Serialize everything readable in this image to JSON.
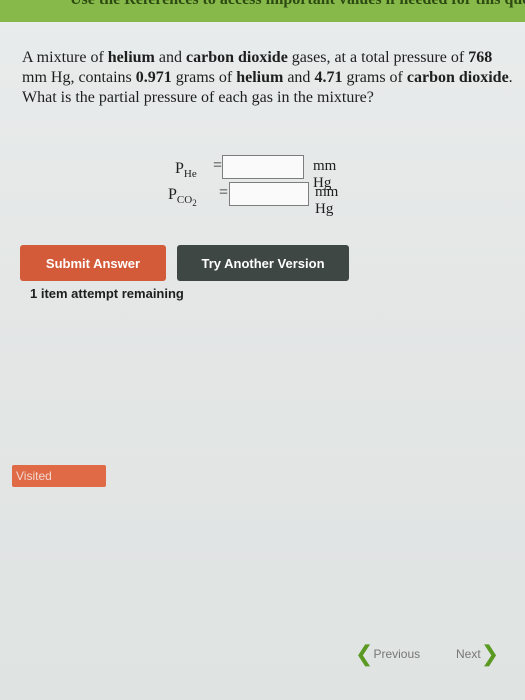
{
  "banner": {
    "text": "Use the References to access important values if needed for this question."
  },
  "question": {
    "parts": [
      {
        "t": "A mixture of ",
        "b": false
      },
      {
        "t": "helium",
        "b": true
      },
      {
        "t": " and ",
        "b": false
      },
      {
        "t": "carbon dioxide",
        "b": true
      },
      {
        "t": " gases, at a total pressure of ",
        "b": false
      },
      {
        "t": "768",
        "b": true
      },
      {
        "t": " mm Hg, contains ",
        "b": false
      },
      {
        "t": "0.971",
        "b": true
      },
      {
        "t": " grams of ",
        "b": false
      },
      {
        "t": "helium",
        "b": true
      },
      {
        "t": " and ",
        "b": false
      },
      {
        "t": "4.71",
        "b": true
      },
      {
        "t": " grams of ",
        "b": false
      },
      {
        "t": "carbon dioxide",
        "b": true
      },
      {
        "t": ". What is the partial pressure of each gas in the mixture?",
        "b": false
      }
    ]
  },
  "answers": {
    "he": {
      "symbol": "P",
      "subscript": "He",
      "equals": "=",
      "value": "",
      "unit": "mm Hg"
    },
    "co2": {
      "symbol": "P",
      "subscript": "CO",
      "subscript2": "2",
      "equals": "=",
      "value": "",
      "unit": "mm Hg"
    }
  },
  "buttons": {
    "submit": "Submit Answer",
    "try_another": "Try Another Version"
  },
  "attempts": "1 item attempt remaining",
  "visited": "Visited",
  "nav": {
    "previous": "Previous",
    "next": "Next",
    "chevron_left": "❮",
    "chevron_right": "❯"
  },
  "colors": {
    "submit": "#d45b3a",
    "try_another": "#3f4745",
    "visited": "#df6a45",
    "banner": "#86b94a",
    "nav_accent": "#5a9a22"
  }
}
